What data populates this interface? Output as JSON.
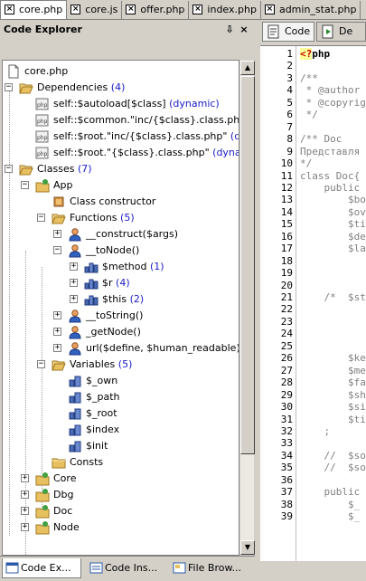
{
  "tabs": [
    {
      "label": "core.php",
      "active": true
    },
    {
      "label": "core.js",
      "active": false
    },
    {
      "label": "offer.php",
      "active": false
    },
    {
      "label": "index.php",
      "active": false
    },
    {
      "label": "admin_stat.php",
      "active": false
    }
  ],
  "explorer": {
    "title": "Code Explorer",
    "pin": "ᵖ",
    "close": "×"
  },
  "tree": {
    "root": "core.php",
    "dependencies": {
      "label": "Dependencies",
      "count": "(4)"
    },
    "deps": [
      {
        "text": "self::$autoload[$class]",
        "tag": "(dynamic)"
      },
      {
        "text": "self::$common.\"inc/{$class}.class.php\"",
        "tag": "(c"
      },
      {
        "text": "self::$root.\"inc/{$class}.class.php\"",
        "tag": "(dyna"
      },
      {
        "text": "self::$root.\"{$class}.class.php\"",
        "tag": "(dynamic)"
      }
    ],
    "classes": {
      "label": "Classes",
      "count": "(7)"
    },
    "app": "App",
    "constructor": "Class constructor",
    "functions": {
      "label": "Functions",
      "count": "(5)"
    },
    "fn_construct": "__construct($args)",
    "fn_tonode": "__toNode()",
    "tonode_children": [
      {
        "text": "$method",
        "count": "(1)"
      },
      {
        "text": "$r",
        "count": "(4)"
      },
      {
        "text": "$this",
        "count": "(2)"
      }
    ],
    "fn_tostring": "__toString()",
    "fn_getnode": "_getNode()",
    "fn_url": "url($define, $human_readable)",
    "variables": {
      "label": "Variables",
      "count": "(5)"
    },
    "vars": [
      "$_own",
      "$_path",
      "$_root",
      "$index",
      "$init"
    ],
    "consts": "Consts",
    "other_classes": [
      "Core",
      "Dbg",
      "Doc",
      "Node"
    ]
  },
  "bottom_tabs": [
    "Code Ex...",
    "Code Ins...",
    "File Brow..."
  ],
  "view_tabs": [
    "Code",
    "De"
  ],
  "editor": {
    "line_numbers": [
      "1",
      "2",
      "3",
      "4",
      "5",
      "6",
      "7",
      "8",
      "9",
      "10",
      "11",
      "12",
      "13",
      "14",
      "15",
      "16",
      "17",
      "18",
      "19",
      "20",
      "21",
      "22",
      "23",
      "24",
      "25",
      "26",
      "27",
      "28",
      "29",
      "30",
      "31",
      "32",
      "33",
      "34",
      "35",
      "36",
      "37",
      "38",
      "39"
    ],
    "lines": [
      "<?php",
      "",
      "/**",
      " * @author",
      " * @copyrig",
      " */",
      "",
      "/** Doc",
      "Представля",
      "*/",
      "class Doc{",
      "    public",
      "        $bo",
      "        $ov",
      "        $ti",
      "        $de",
      "        $la",
      "",
      "",
      "",
      "    /*  $st",
      "",
      "",
      "",
      "",
      "        $ke",
      "        $me",
      "        $fa",
      "        $sh",
      "        $si",
      "        $ti",
      "    ;",
      "",
      "    //  $so",
      "    //  $so",
      "",
      "    public",
      "        $_",
      "        $_"
    ]
  },
  "colors": {
    "count": "#1a1acc",
    "folder": "#e8c060",
    "panel": "#d4d0c8"
  }
}
